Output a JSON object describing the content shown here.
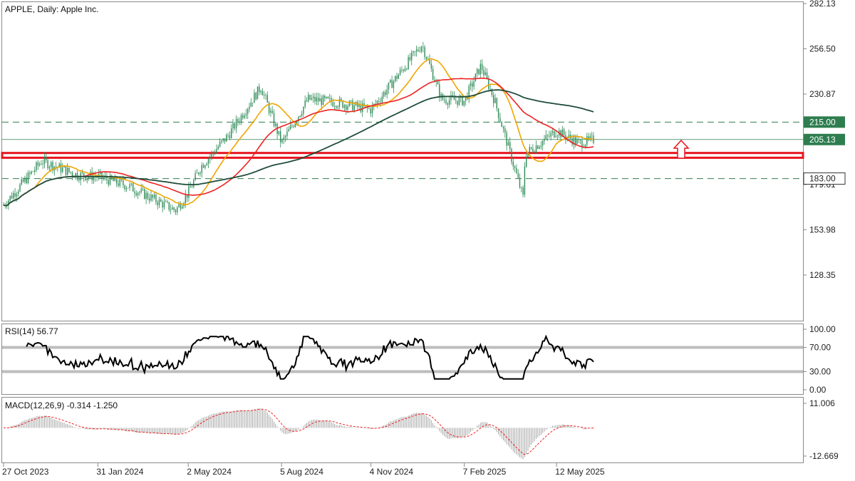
{
  "title": "APPLE, Daily:  Apple Inc.",
  "colors": {
    "candle": "#2e8b57",
    "ma_fast": "#f0a500",
    "ma_mid": "#e22",
    "ma_slow": "#1f4d3a",
    "support_zone": "#e8141e",
    "arrow": "#e8141e",
    "level_line": "#2e7d4f",
    "price_tag_bg": "#2e7d4f",
    "rsi_line": "#000000",
    "rsi_band": "#bdbdbd",
    "macd_hist": "#9e9e9e",
    "macd_signal": "#e22"
  },
  "price_axis": {
    "ticks": [
      "282.13",
      "256.50",
      "230.87",
      "205.13",
      "179.61",
      "153.98",
      "128.35"
    ],
    "tags": [
      {
        "label": "215.00",
        "value": 215.0
      },
      {
        "label": "205.13",
        "value": 205.13
      },
      {
        "label": "183.00",
        "value": 183.0
      }
    ]
  },
  "date_axis": {
    "ticks": [
      "27 Oct 2023",
      "31 Jan 2024",
      "2 May 2024",
      "5 Aug 2024",
      "4 Nov 2024",
      "7 Feb 2025",
      "12 May 2025"
    ]
  },
  "rsi": {
    "label": "RSI(14) 56.77",
    "ticks": [
      "100.00",
      "70.00",
      "30.00",
      "0.00"
    ]
  },
  "macd": {
    "label": "MACD(12,26,9) -0.314 -1.250",
    "ticks": [
      "11.006",
      "-12.669"
    ]
  },
  "chart_data": {
    "type": "candlestick",
    "symbol": "APPLE",
    "timeframe": "Daily",
    "description": "Apple Inc.",
    "y_range": [
      107,
      282.13
    ],
    "last_price": 205.13,
    "levels": {
      "resistance_dashed": 215.0,
      "support_dashed": 183.0,
      "support_zone": [
        194.8,
        197.5
      ]
    },
    "close_keypoints": [
      {
        "date": "2023-10-27",
        "close": 168
      },
      {
        "date": "2023-12-05",
        "close": 193
      },
      {
        "date": "2024-01-10",
        "close": 185
      },
      {
        "date": "2024-01-31",
        "close": 184
      },
      {
        "date": "2024-03-01",
        "close": 179
      },
      {
        "date": "2024-04-19",
        "close": 165
      },
      {
        "date": "2024-05-02",
        "close": 175
      },
      {
        "date": "2024-05-15",
        "close": 190
      },
      {
        "date": "2024-06-11",
        "close": 207
      },
      {
        "date": "2024-07-15",
        "close": 235
      },
      {
        "date": "2024-08-05",
        "close": 203
      },
      {
        "date": "2024-09-01",
        "close": 228
      },
      {
        "date": "2024-10-01",
        "close": 226
      },
      {
        "date": "2024-11-04",
        "close": 222
      },
      {
        "date": "2024-12-26",
        "close": 259
      },
      {
        "date": "2025-01-15",
        "close": 228
      },
      {
        "date": "2025-02-07",
        "close": 227
      },
      {
        "date": "2025-02-24",
        "close": 247
      },
      {
        "date": "2025-03-10",
        "close": 227
      },
      {
        "date": "2025-04-08",
        "close": 172
      },
      {
        "date": "2025-04-10",
        "close": 197
      },
      {
        "date": "2025-05-12",
        "close": 210
      },
      {
        "date": "2025-06-04",
        "close": 203
      },
      {
        "date": "2025-06-20",
        "close": 205.13
      }
    ],
    "moving_averages": [
      {
        "name": "fast",
        "end_value": 203
      },
      {
        "name": "mid",
        "end_value": 212
      },
      {
        "name": "slow",
        "end_value": 222
      }
    ],
    "rsi_value": 56.77,
    "rsi_levels": [
      70,
      30
    ],
    "macd_values": {
      "main": -0.314,
      "signal": -1.25
    },
    "macd_range": [
      -12.669,
      11.006
    ]
  }
}
